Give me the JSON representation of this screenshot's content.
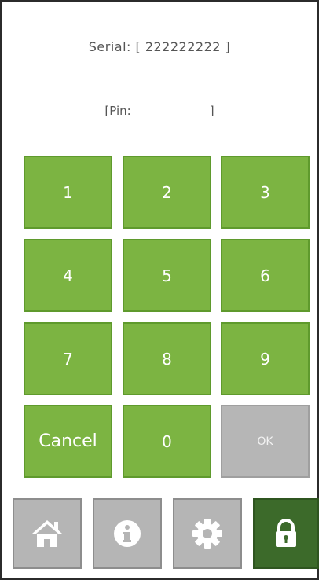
{
  "info": {
    "serial_text": "Serial: [ 222222222 ]",
    "pin_open": "[Pin:",
    "pin_close": "]"
  },
  "keypad": {
    "keys": [
      "1",
      "2",
      "3",
      "4",
      "5",
      "6",
      "7",
      "8",
      "9",
      "Cancel",
      "0",
      "OK"
    ]
  },
  "nav": {
    "home_icon": "home-icon",
    "info_icon": "info-icon",
    "settings_icon": "gear-icon",
    "lock_icon": "lock-icon"
  },
  "colors": {
    "key_green": "#7cb442",
    "ok_grey": "#b6b6b6",
    "nav_grey": "#b5b5b5",
    "nav_active": "#3c6a2a"
  }
}
